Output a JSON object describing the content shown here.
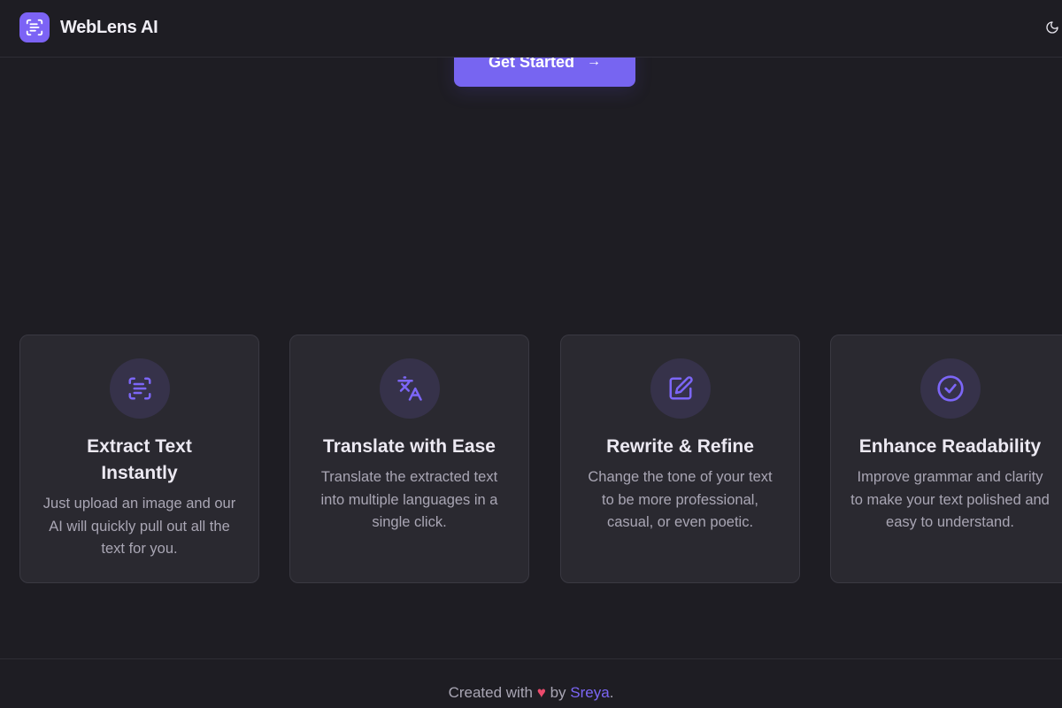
{
  "header": {
    "brand": "WebLens AI",
    "logo_icon": "scan-text-icon",
    "theme_icon": "moon-icon"
  },
  "cta": {
    "label": "Get Started",
    "arrow": "→",
    "arrow_icon": "arrow-right-icon"
  },
  "features": [
    {
      "icon": "scan-text-icon",
      "title": "Extract Text Instantly",
      "description": "Just upload an image and our AI will quickly pull out all the text for you."
    },
    {
      "icon": "languages-icon",
      "title": "Translate with Ease",
      "description": "Translate the extracted text into multiple languages in a single click."
    },
    {
      "icon": "edit-icon",
      "title": "Rewrite & Refine",
      "description": "Change the tone of your text to be more professional, casual, or even poetic."
    },
    {
      "icon": "check-circle-icon",
      "title": "Enhance Readability",
      "description": "Improve grammar and clarity to make your text polished and easy to understand."
    }
  ],
  "footer": {
    "prefix": "Created with",
    "heart": "♥",
    "by": "by",
    "author": "Sreya",
    "suffix": "."
  },
  "colors": {
    "background": "#1e1d23",
    "card": "#2a2930",
    "accent": "#7765f1",
    "heart": "#ec4a6c"
  }
}
